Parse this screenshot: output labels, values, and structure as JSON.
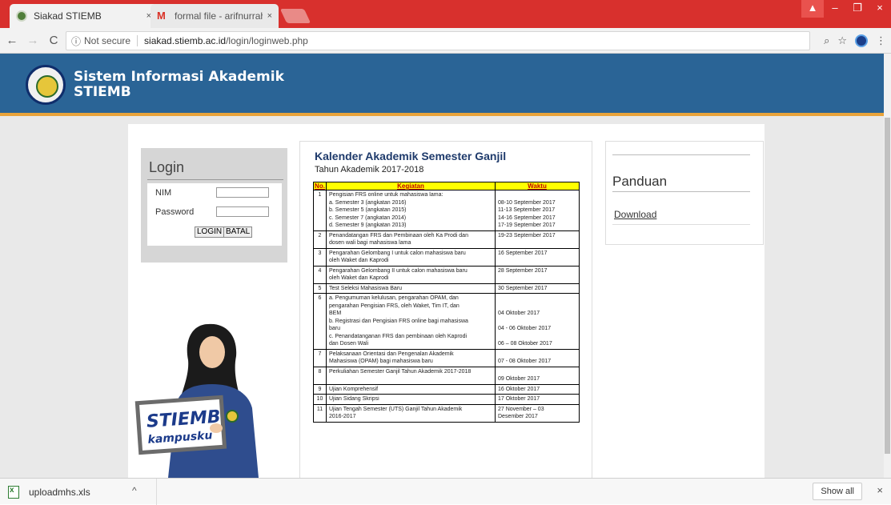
{
  "browser": {
    "tabs": [
      {
        "title": "Siakad STIEMB",
        "close": "×",
        "favicon_color": "#4f7e3a"
      },
      {
        "title": "formal file - arifnurrahma",
        "close": "×",
        "favicon_color": "#d93025"
      }
    ],
    "nav": {
      "back": "←",
      "forward": "→",
      "reload": "C"
    },
    "security_icon": "ⓘ",
    "security_text": "Not secure",
    "url_host": "siakad.stiemb.ac.id",
    "url_path": "/login/loginweb.php",
    "toolbar_icons": {
      "zoom": "⌕",
      "bookmark": "☆",
      "menu": "⋮"
    },
    "window_controls": {
      "user": "▲",
      "minimize": "–",
      "restore": "❐",
      "close": "×"
    }
  },
  "site": {
    "title_line1": "Sistem Informasi Akademik",
    "title_line2": "STIEMB",
    "banner_color": "#2a6496",
    "accent_color": "#e8a33a"
  },
  "login": {
    "heading": "Login",
    "nim_label": "NIM",
    "password_label": "Password",
    "login_button": "LOGIN",
    "cancel_button": "BATAL"
  },
  "calendar": {
    "title": "Kalender Akademik Semester Ganjil",
    "subtitle": "Tahun Akademik 2017-2018",
    "headers": {
      "no": "No.",
      "activity": "Kegiatan",
      "time": "Waktu"
    },
    "rows": [
      {
        "no": "1",
        "activity": [
          "Pengisian FRS online untuk mahasiswa lama:",
          "a. Semester 3 (angkatan 2016)",
          "b. Semester 5 (angkatan 2015)",
          "c. Semester 7 (angkatan 2014)",
          "d. Semester 9 (angkatan 2013)"
        ],
        "time": [
          "",
          "08-10 September 2017",
          "11-13 September 2017",
          "14-16 September 2017",
          "17-19 September 2017"
        ]
      },
      {
        "no": "2",
        "activity": [
          "Penandatangan FRS dan Pembinaan oleh Ka Prodi dan",
          "dosen wali bagi mahasiswa lama"
        ],
        "time": [
          "19-23 September 2017"
        ]
      },
      {
        "no": "3",
        "activity": [
          "Pengarahan Gelombang I untuk calon mahasiswa baru",
          "oleh Waket dan Kaprodi"
        ],
        "time": [
          "16 September 2017"
        ]
      },
      {
        "no": "4",
        "activity": [
          "Pengarahan Gelombang II untuk calon mahasiswa baru",
          "oleh Waket dan Kaprodi"
        ],
        "time": [
          "28 September 2017"
        ]
      },
      {
        "no": "5",
        "activity": [
          "Test Seleksi Mahasiswa Baru"
        ],
        "time": [
          "30 September 2017"
        ]
      },
      {
        "no": "6",
        "activity": [
          "a. Pengumuman kelulusan, pengarahan OPAM, dan",
          "    pengarahan Pengisian FRS, oleh Waket, Tim IT, dan",
          "    BEM",
          "b. Registrasi dan Pengisian FRS online bagi mahasiswa",
          "    baru",
          "c. Penandatanganan FRS dan pembinaan oleh Kaprodi",
          "    dan Dosen Wali"
        ],
        "time": [
          "",
          "",
          "04 Oktober 2017",
          "",
          "04 - 06 Oktober 2017",
          "",
          "06 – 08 Oktober 2017"
        ]
      },
      {
        "no": "7",
        "activity": [
          "Pelaksanaan Orientasi dan Pengenalan Akademik",
          "Mahasiswa (OPAM) bagi mahasiswa baru"
        ],
        "time": [
          "",
          "07 - 08 Oktober 2017"
        ]
      },
      {
        "no": "8",
        "activity": [
          "Perkuliahan Semester Ganjil Tahun Akademik 2017-2018",
          ""
        ],
        "time": [
          "",
          "09 Oktober 2017"
        ]
      },
      {
        "no": "9",
        "activity": [
          "Ujian Komprehensif"
        ],
        "time": [
          "16 Oktober 2017"
        ]
      },
      {
        "no": "10",
        "activity": [
          "Ujian Sidang Skripsi"
        ],
        "time": [
          "17 Oktober 2017"
        ]
      },
      {
        "no": "11",
        "activity": [
          "Ujian Tengah Semester (UTS) Ganjil Tahun Akademik",
          "2016-2017"
        ],
        "time": [
          "27 November – 03",
          "Desember 2017"
        ]
      }
    ]
  },
  "guide": {
    "heading": "Panduan",
    "download_link": "Download"
  },
  "mascot": {
    "sign_line1": "STIEMB",
    "sign_line2": "kampusku"
  },
  "downloads": {
    "file_name": "uploadmhs.xls",
    "caret": "^",
    "show_all": "Show all",
    "close": "×"
  }
}
